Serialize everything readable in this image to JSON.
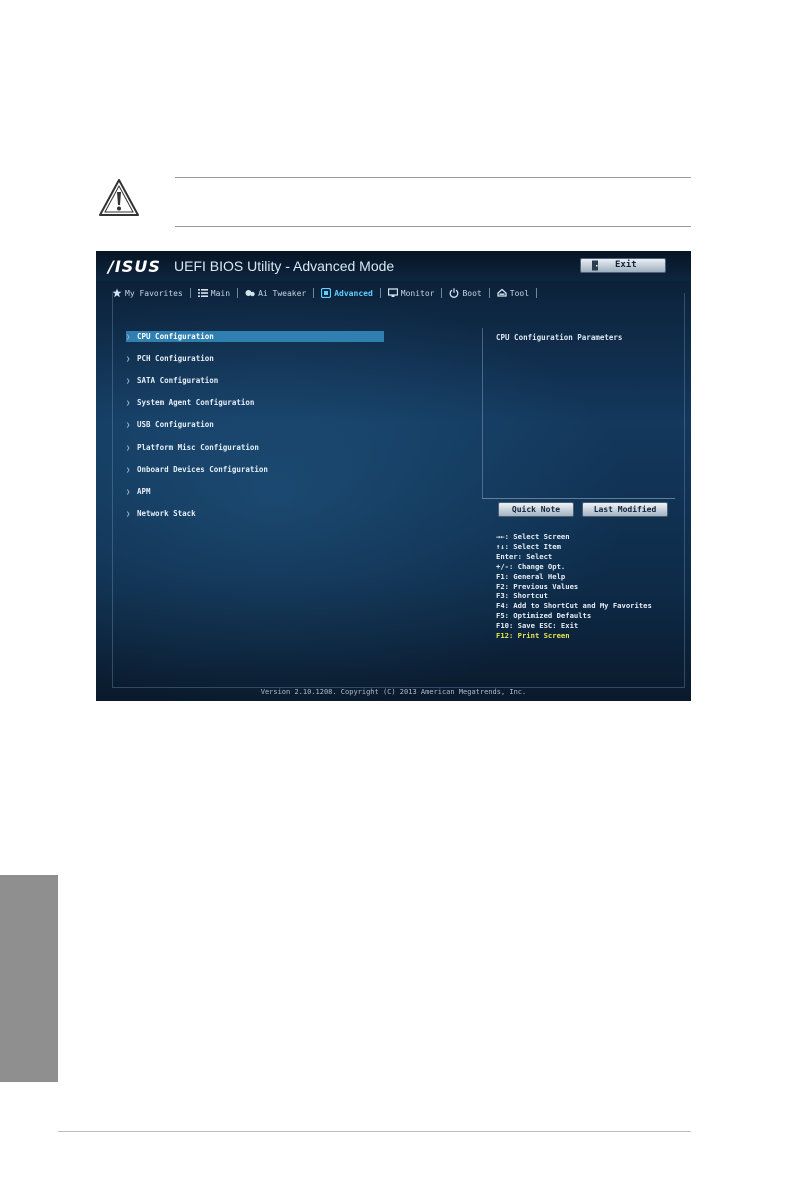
{
  "bios": {
    "brand": "/ISUS",
    "title": "UEFI BIOS Utility - Advanced Mode",
    "exit_label": "Exit",
    "tabs": [
      {
        "label": "My Favorites",
        "icon": "star-icon"
      },
      {
        "label": "Main",
        "icon": "list-icon"
      },
      {
        "label": "Ai Tweaker",
        "icon": "tweaker-icon"
      },
      {
        "label": "Advanced",
        "icon": "advanced-icon",
        "active": true
      },
      {
        "label": "Monitor",
        "icon": "monitor-icon"
      },
      {
        "label": "Boot",
        "icon": "power-icon"
      },
      {
        "label": "Tool",
        "icon": "tool-icon"
      }
    ],
    "menu": [
      "CPU Configuration",
      "PCH Configuration",
      "SATA Configuration",
      "System Agent Configuration",
      "USB Configuration",
      "Platform Misc Configuration",
      "Onboard Devices Configuration",
      "APM",
      "Network Stack"
    ],
    "selected_index": 0,
    "description": "CPU Configuration Parameters",
    "quick_note_label": "Quick Note",
    "last_modified_label": "Last Modified",
    "keys": [
      "→←: Select Screen",
      "↑↓: Select Item",
      "Enter: Select",
      "+/-: Change Opt.",
      "F1: General Help",
      "F2: Previous Values",
      "F3: Shortcut",
      "F4: Add to ShortCut and My Favorites",
      "F5: Optimized Defaults",
      "F10: Save  ESC: Exit",
      "F12: Print Screen"
    ],
    "version": "Version 2.10.1208. Copyright (C) 2013 American Megatrends, Inc.",
    "colors": {
      "accent": "#5fd0ff",
      "selection": "#2f7fb0",
      "highlight_key": "#e8e64d"
    }
  }
}
